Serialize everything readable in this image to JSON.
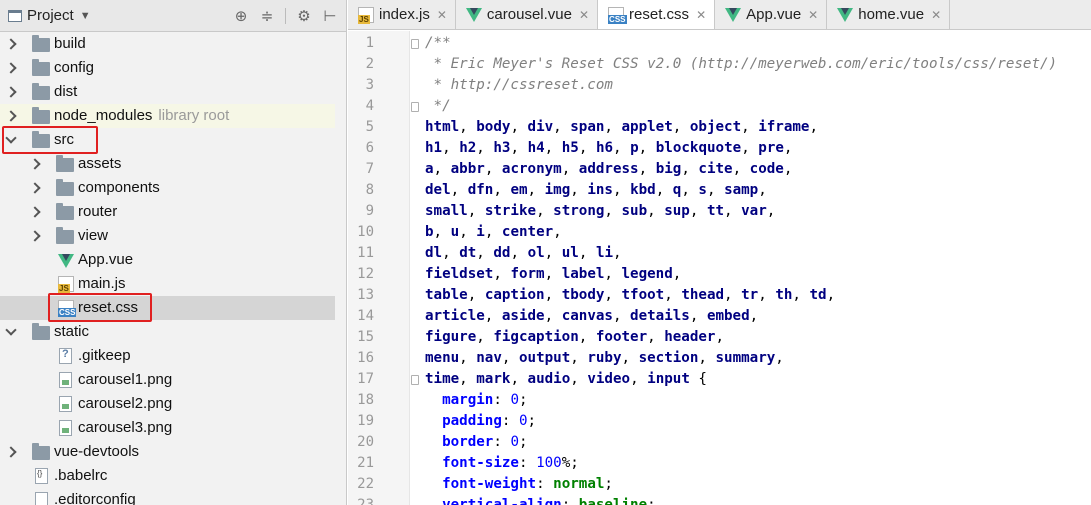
{
  "project_panel": {
    "title": "Project",
    "tree": [
      {
        "label": "build",
        "type": "folder",
        "depth": 0,
        "expanded": false
      },
      {
        "label": "config",
        "type": "folder",
        "depth": 0,
        "expanded": false
      },
      {
        "label": "dist",
        "type": "folder",
        "depth": 0,
        "expanded": false
      },
      {
        "label": "node_modules",
        "sublabel": "library root",
        "type": "folder",
        "depth": 0,
        "expanded": false
      },
      {
        "label": "src",
        "type": "folder",
        "depth": 0,
        "expanded": true
      },
      {
        "label": "assets",
        "type": "folder",
        "depth": 1,
        "expanded": false
      },
      {
        "label": "components",
        "type": "folder",
        "depth": 1,
        "expanded": false
      },
      {
        "label": "router",
        "type": "folder",
        "depth": 1,
        "expanded": false
      },
      {
        "label": "view",
        "type": "folder",
        "depth": 1,
        "expanded": false
      },
      {
        "label": "App.vue",
        "type": "vue",
        "depth": 1
      },
      {
        "label": "main.js",
        "type": "js",
        "depth": 1
      },
      {
        "label": "reset.css",
        "type": "css",
        "depth": 1
      },
      {
        "label": "static",
        "type": "folder",
        "depth": 0,
        "expanded": true
      },
      {
        "label": ".gitkeep",
        "type": "unknown",
        "depth": 1
      },
      {
        "label": "carousel1.png",
        "type": "image",
        "depth": 1
      },
      {
        "label": "carousel2.png",
        "type": "image",
        "depth": 1
      },
      {
        "label": "carousel3.png",
        "type": "image",
        "depth": 1
      },
      {
        "label": "vue-devtools",
        "type": "folder",
        "depth": 0,
        "expanded": false
      },
      {
        "label": ".babelrc",
        "type": "json",
        "depth": 0
      },
      {
        "label": ".editorconfig",
        "type": "file",
        "depth": 0
      }
    ]
  },
  "editor": {
    "tabs": [
      {
        "label": "index.js",
        "type": "js"
      },
      {
        "label": "carousel.vue",
        "type": "vue"
      },
      {
        "label": "reset.css",
        "type": "css",
        "active": true
      },
      {
        "label": "App.vue",
        "type": "vue"
      },
      {
        "label": "home.vue",
        "type": "vue"
      }
    ],
    "lines": [
      {
        "n": "1",
        "tokens": [
          [
            "cmt",
            "/**"
          ]
        ]
      },
      {
        "n": "2",
        "tokens": [
          [
            "cmt",
            " * Eric Meyer's Reset CSS v2.0 (http://meyerweb.com/eric/tools/css/reset/)"
          ]
        ]
      },
      {
        "n": "3",
        "tokens": [
          [
            "cmt",
            " * http://cssreset.com"
          ]
        ]
      },
      {
        "n": "4",
        "tokens": [
          [
            "cmt",
            " */"
          ]
        ]
      },
      {
        "n": "5",
        "tokens": [
          [
            "sel",
            "html"
          ],
          [
            "punc",
            ", "
          ],
          [
            "sel",
            "body"
          ],
          [
            "punc",
            ", "
          ],
          [
            "sel",
            "div"
          ],
          [
            "punc",
            ", "
          ],
          [
            "sel",
            "span"
          ],
          [
            "punc",
            ", "
          ],
          [
            "sel",
            "applet"
          ],
          [
            "punc",
            ", "
          ],
          [
            "sel",
            "object"
          ],
          [
            "punc",
            ", "
          ],
          [
            "sel",
            "iframe"
          ],
          [
            "punc",
            ","
          ]
        ]
      },
      {
        "n": "6",
        "tokens": [
          [
            "sel",
            "h1"
          ],
          [
            "punc",
            ", "
          ],
          [
            "sel",
            "h2"
          ],
          [
            "punc",
            ", "
          ],
          [
            "sel",
            "h3"
          ],
          [
            "punc",
            ", "
          ],
          [
            "sel",
            "h4"
          ],
          [
            "punc",
            ", "
          ],
          [
            "sel",
            "h5"
          ],
          [
            "punc",
            ", "
          ],
          [
            "sel",
            "h6"
          ],
          [
            "punc",
            ", "
          ],
          [
            "sel",
            "p"
          ],
          [
            "punc",
            ", "
          ],
          [
            "sel",
            "blockquote"
          ],
          [
            "punc",
            ", "
          ],
          [
            "sel",
            "pre"
          ],
          [
            "punc",
            ","
          ]
        ]
      },
      {
        "n": "7",
        "tokens": [
          [
            "sel",
            "a"
          ],
          [
            "punc",
            ", "
          ],
          [
            "sel",
            "abbr"
          ],
          [
            "punc",
            ", "
          ],
          [
            "sel",
            "acronym"
          ],
          [
            "punc",
            ", "
          ],
          [
            "sel",
            "address"
          ],
          [
            "punc",
            ", "
          ],
          [
            "sel",
            "big"
          ],
          [
            "punc",
            ", "
          ],
          [
            "sel",
            "cite"
          ],
          [
            "punc",
            ", "
          ],
          [
            "sel",
            "code"
          ],
          [
            "punc",
            ","
          ]
        ]
      },
      {
        "n": "8",
        "tokens": [
          [
            "sel",
            "del"
          ],
          [
            "punc",
            ", "
          ],
          [
            "sel",
            "dfn"
          ],
          [
            "punc",
            ", "
          ],
          [
            "sel",
            "em"
          ],
          [
            "punc",
            ", "
          ],
          [
            "sel",
            "img"
          ],
          [
            "punc",
            ", "
          ],
          [
            "sel",
            "ins"
          ],
          [
            "punc",
            ", "
          ],
          [
            "sel",
            "kbd"
          ],
          [
            "punc",
            ", "
          ],
          [
            "sel",
            "q"
          ],
          [
            "punc",
            ", "
          ],
          [
            "sel",
            "s"
          ],
          [
            "punc",
            ", "
          ],
          [
            "sel",
            "samp"
          ],
          [
            "punc",
            ","
          ]
        ]
      },
      {
        "n": "9",
        "tokens": [
          [
            "sel",
            "small"
          ],
          [
            "punc",
            ", "
          ],
          [
            "sel",
            "strike"
          ],
          [
            "punc",
            ", "
          ],
          [
            "sel",
            "strong"
          ],
          [
            "punc",
            ", "
          ],
          [
            "sel",
            "sub"
          ],
          [
            "punc",
            ", "
          ],
          [
            "sel",
            "sup"
          ],
          [
            "punc",
            ", "
          ],
          [
            "sel",
            "tt"
          ],
          [
            "punc",
            ", "
          ],
          [
            "sel",
            "var"
          ],
          [
            "punc",
            ","
          ]
        ]
      },
      {
        "n": "10",
        "tokens": [
          [
            "sel",
            "b"
          ],
          [
            "punc",
            ", "
          ],
          [
            "sel",
            "u"
          ],
          [
            "punc",
            ", "
          ],
          [
            "sel",
            "i"
          ],
          [
            "punc",
            ", "
          ],
          [
            "sel",
            "center"
          ],
          [
            "punc",
            ","
          ]
        ]
      },
      {
        "n": "11",
        "tokens": [
          [
            "sel",
            "dl"
          ],
          [
            "punc",
            ", "
          ],
          [
            "sel",
            "dt"
          ],
          [
            "punc",
            ", "
          ],
          [
            "sel",
            "dd"
          ],
          [
            "punc",
            ", "
          ],
          [
            "sel",
            "ol"
          ],
          [
            "punc",
            ", "
          ],
          [
            "sel",
            "ul"
          ],
          [
            "punc",
            ", "
          ],
          [
            "sel",
            "li"
          ],
          [
            "punc",
            ","
          ]
        ]
      },
      {
        "n": "12",
        "tokens": [
          [
            "sel",
            "fieldset"
          ],
          [
            "punc",
            ", "
          ],
          [
            "sel",
            "form"
          ],
          [
            "punc",
            ", "
          ],
          [
            "sel",
            "label"
          ],
          [
            "punc",
            ", "
          ],
          [
            "sel",
            "legend"
          ],
          [
            "punc",
            ","
          ]
        ]
      },
      {
        "n": "13",
        "tokens": [
          [
            "sel",
            "table"
          ],
          [
            "punc",
            ", "
          ],
          [
            "sel",
            "caption"
          ],
          [
            "punc",
            ", "
          ],
          [
            "sel",
            "tbody"
          ],
          [
            "punc",
            ", "
          ],
          [
            "sel",
            "tfoot"
          ],
          [
            "punc",
            ", "
          ],
          [
            "sel",
            "thead"
          ],
          [
            "punc",
            ", "
          ],
          [
            "sel",
            "tr"
          ],
          [
            "punc",
            ", "
          ],
          [
            "sel",
            "th"
          ],
          [
            "punc",
            ", "
          ],
          [
            "sel",
            "td"
          ],
          [
            "punc",
            ","
          ]
        ]
      },
      {
        "n": "14",
        "tokens": [
          [
            "sel",
            "article"
          ],
          [
            "punc",
            ", "
          ],
          [
            "sel",
            "aside"
          ],
          [
            "punc",
            ", "
          ],
          [
            "sel",
            "canvas"
          ],
          [
            "punc",
            ", "
          ],
          [
            "sel",
            "details"
          ],
          [
            "punc",
            ", "
          ],
          [
            "sel",
            "embed"
          ],
          [
            "punc",
            ","
          ]
        ]
      },
      {
        "n": "15",
        "tokens": [
          [
            "sel",
            "figure"
          ],
          [
            "punc",
            ", "
          ],
          [
            "sel",
            "figcaption"
          ],
          [
            "punc",
            ", "
          ],
          [
            "sel",
            "footer"
          ],
          [
            "punc",
            ", "
          ],
          [
            "sel",
            "header"
          ],
          [
            "punc",
            ","
          ]
        ]
      },
      {
        "n": "16",
        "tokens": [
          [
            "sel",
            "menu"
          ],
          [
            "punc",
            ", "
          ],
          [
            "sel",
            "nav"
          ],
          [
            "punc",
            ", "
          ],
          [
            "sel",
            "output"
          ],
          [
            "punc",
            ", "
          ],
          [
            "sel",
            "ruby"
          ],
          [
            "punc",
            ", "
          ],
          [
            "sel",
            "section"
          ],
          [
            "punc",
            ", "
          ],
          [
            "sel",
            "summary"
          ],
          [
            "punc",
            ","
          ]
        ]
      },
      {
        "n": "17",
        "tokens": [
          [
            "sel",
            "time"
          ],
          [
            "punc",
            ", "
          ],
          [
            "sel",
            "mark"
          ],
          [
            "punc",
            ", "
          ],
          [
            "sel",
            "audio"
          ],
          [
            "punc",
            ", "
          ],
          [
            "sel",
            "video"
          ],
          [
            "punc",
            ", "
          ],
          [
            "sel",
            "input"
          ],
          [
            "punc",
            " {"
          ]
        ]
      },
      {
        "n": "18",
        "tokens": [
          [
            "punc",
            "  "
          ],
          [
            "prop",
            "margin"
          ],
          [
            "punc",
            ": "
          ],
          [
            "num",
            "0"
          ],
          [
            "punc",
            ";"
          ]
        ]
      },
      {
        "n": "19",
        "tokens": [
          [
            "punc",
            "  "
          ],
          [
            "prop",
            "padding"
          ],
          [
            "punc",
            ": "
          ],
          [
            "num",
            "0"
          ],
          [
            "punc",
            ";"
          ]
        ]
      },
      {
        "n": "20",
        "tokens": [
          [
            "punc",
            "  "
          ],
          [
            "prop",
            "border"
          ],
          [
            "punc",
            ": "
          ],
          [
            "num",
            "0"
          ],
          [
            "punc",
            ";"
          ]
        ]
      },
      {
        "n": "21",
        "tokens": [
          [
            "punc",
            "  "
          ],
          [
            "prop",
            "font-size"
          ],
          [
            "punc",
            ": "
          ],
          [
            "num",
            "100"
          ],
          [
            "punc",
            "%;"
          ]
        ]
      },
      {
        "n": "22",
        "tokens": [
          [
            "punc",
            "  "
          ],
          [
            "prop",
            "font-weight"
          ],
          [
            "punc",
            ": "
          ],
          [
            "val",
            "normal"
          ],
          [
            "punc",
            ";"
          ]
        ]
      },
      {
        "n": "23",
        "tokens": [
          [
            "punc",
            "  "
          ],
          [
            "prop",
            "vertical-align"
          ],
          [
            "punc",
            ": "
          ],
          [
            "val",
            "baseline"
          ],
          [
            "punc",
            ";"
          ]
        ]
      }
    ]
  },
  "colors": {
    "highlight_box": "#e02020",
    "selector": "#000080",
    "property": "#0000ff",
    "comment": "#808080",
    "value": "#008000"
  }
}
